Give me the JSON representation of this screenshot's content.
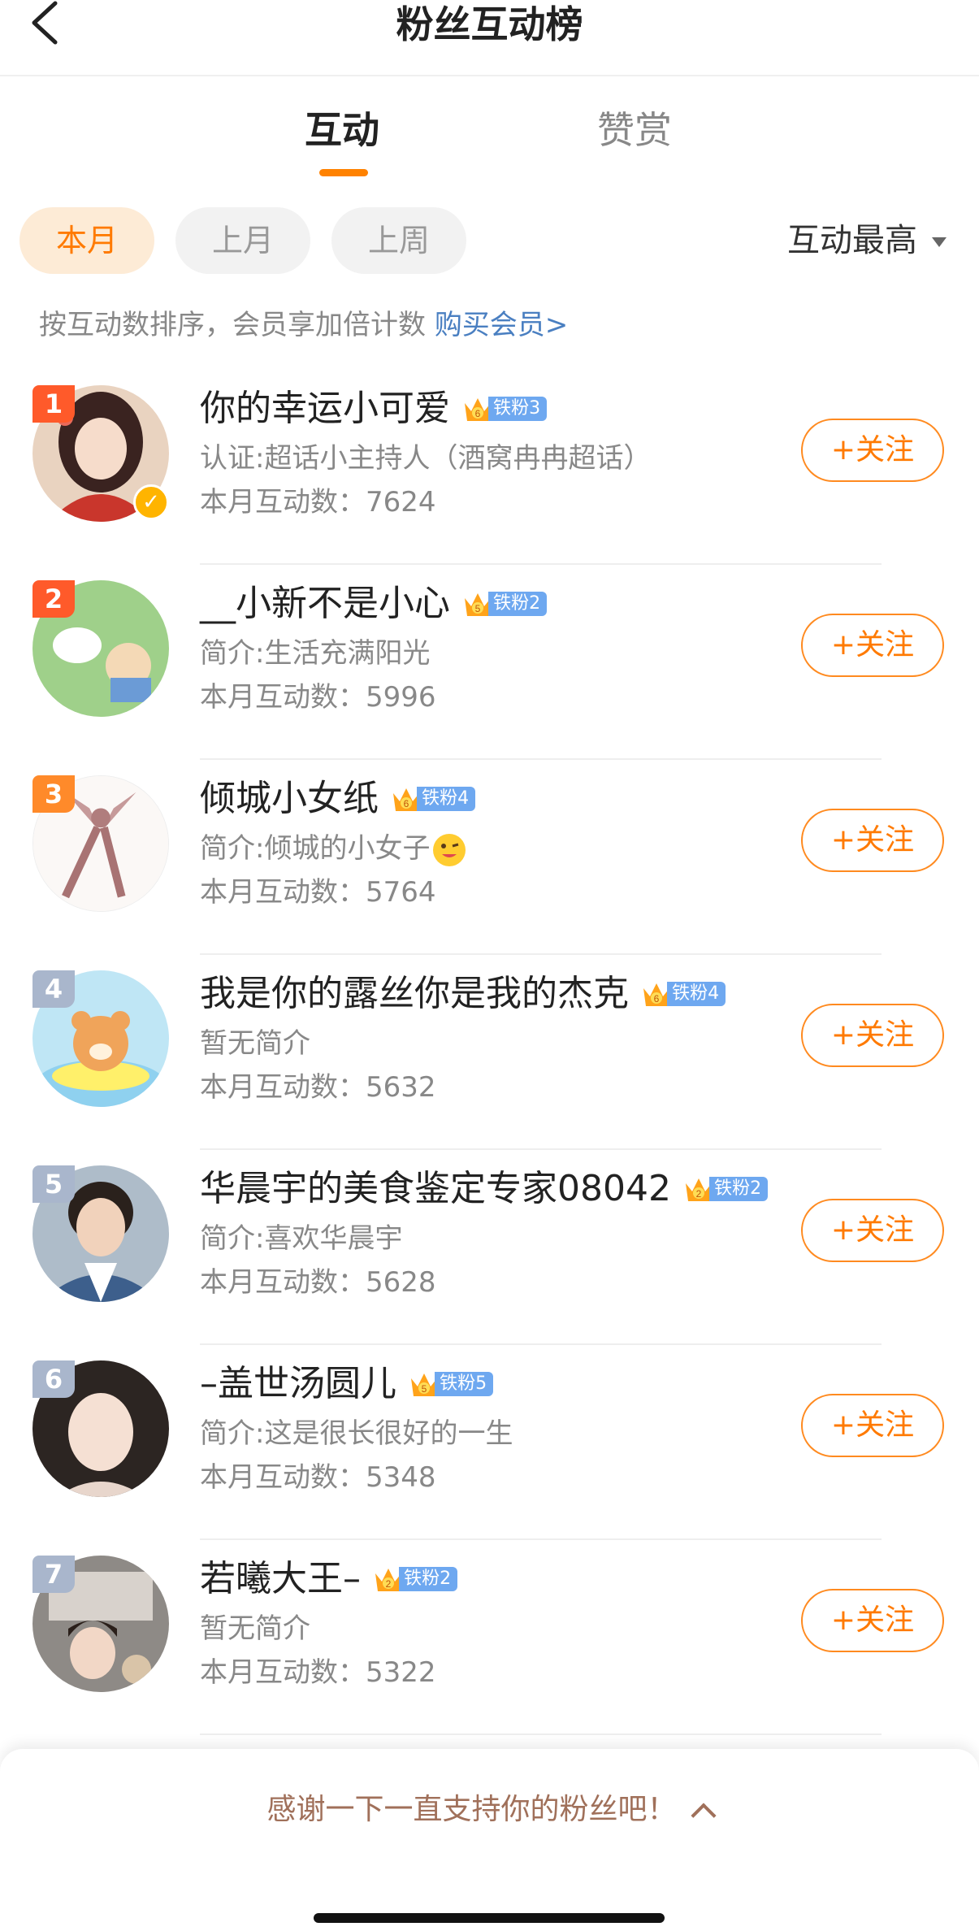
{
  "header": {
    "title": "粉丝互动榜",
    "back_icon": "chevron-left-icon"
  },
  "tabs": [
    {
      "label": "互动",
      "active": true
    },
    {
      "label": "赞赏",
      "active": false
    }
  ],
  "accent_color": "#ff8200",
  "filters": [
    {
      "label": "本月",
      "active": true
    },
    {
      "label": "上月",
      "active": false
    },
    {
      "label": "上周",
      "active": false
    }
  ],
  "sort": {
    "label": "互动最高"
  },
  "notice": {
    "text": "按互动数排序，会员享加倍计数 ",
    "link": "购买会员>"
  },
  "follow_label": "+关注",
  "fans": [
    {
      "rank": "1",
      "name": "你的幸运小可爱",
      "badge_level": "6",
      "badge_label": "铁粉3",
      "bio": "认证:超话小主持人（酒窝冉冉超话）",
      "count": "本月互动数：7624",
      "verified": true
    },
    {
      "rank": "2",
      "name": "__小新不是小心",
      "badge_level": "5",
      "badge_label": "铁粉2",
      "bio": "简介:生活充满阳光",
      "count": "本月互动数：5996",
      "verified": false
    },
    {
      "rank": "3",
      "name": "倾城小女纸",
      "badge_level": "6",
      "badge_label": "铁粉4",
      "bio": "简介:倾城的小女子",
      "count": "本月互动数：5764",
      "verified": false
    },
    {
      "rank": "4",
      "name": "我是你的露丝你是我的杰克",
      "badge_level": "6",
      "badge_label": "铁粉4",
      "bio": "暂无简介",
      "count": "本月互动数：5632",
      "verified": false
    },
    {
      "rank": "5",
      "name": "华晨宇的美食鉴定专家08042",
      "badge_level": "2",
      "badge_label": "铁粉2",
      "bio": "简介:喜欢华晨宇",
      "count": "本月互动数：5628",
      "verified": false
    },
    {
      "rank": "6",
      "name": "–盖世汤圆儿",
      "badge_level": "5",
      "badge_label": "铁粉5",
      "bio": "简介:这是很长很好的一生",
      "count": "本月互动数：5348",
      "verified": false
    },
    {
      "rank": "7",
      "name": "若曦大王–",
      "badge_level": "2",
      "badge_label": "铁粉2",
      "bio": "暂无简介",
      "count": "本月互动数：5322",
      "verified": false
    }
  ],
  "bottom_sheet": {
    "text": "感谢一下一直支持你的粉丝吧！"
  }
}
